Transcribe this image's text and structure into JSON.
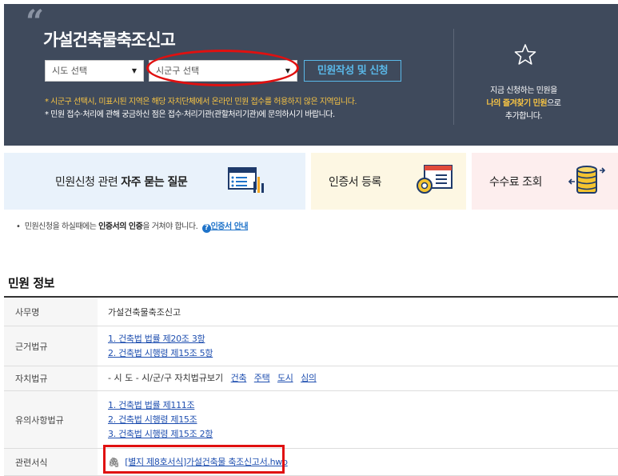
{
  "hero": {
    "title": "가설건축물축조신고",
    "sido_select": "시도 선택",
    "sigungu_select": "시군구 선택",
    "apply_button": "민원작성 및 신청",
    "notice1": "* 시군구 선택시, 미표시된 지역은 해당 자치단체에서 온라인 민원 접수를 허용하지 않은 지역입니다.",
    "notice2": "* 민원 접수·처리에 관해 궁금하신 점은 접수·처리기관(관할처리기관)에 문의하시기 바랍니다.",
    "fav_line1": "지금 신청하는 민원을",
    "fav_highlight": "나의 즐겨찾기 민원",
    "fav_line2_suffix": "으로",
    "fav_line3": "추가합니다."
  },
  "tiles": {
    "faq_prefix": "민원신청 관련 ",
    "faq_bold": "자주 묻는 질문",
    "cert": "인증서 등록",
    "fee": "수수료 조회"
  },
  "cert_note": {
    "prefix": "민원신청을 하실때에는 ",
    "bold": "인증서의 인증",
    "suffix": "을 거쳐야 합니다.",
    "q": "?",
    "link": "인증서 안내"
  },
  "section_title": "민원 정보",
  "info": {
    "work_name_label": "사무명",
    "work_name_value": "가설건축물축조신고",
    "basis_law_label": "근거법규",
    "basis_law_links": [
      "1. 건축법 법률 제20조 3항",
      "2. 건축법 시행령 제15조 5항"
    ],
    "local_law_label": "자치법규",
    "local_law_prefix": "- 시 도 - 시/군/구 자치법규보기",
    "local_law_links": [
      "건축",
      "주택",
      "도시",
      "심의"
    ],
    "caution_law_label": "유의사항법규",
    "caution_law_links": [
      "1. 건축법 법률 제111조",
      "2. 건축법 시행령 제15조",
      "3. 건축법 시행령 제15조 2항"
    ],
    "form_label": "관련서식",
    "form_link": "[별지 제8호서식]가설건축물 축조신고서.hwp"
  },
  "colors": {
    "hero_bg": "#3f4a5c",
    "accent_blue": "#5ab8e8",
    "notice_yellow": "#f6c344",
    "highlight_red": "#e01010",
    "link_blue": "#1f4fb0"
  }
}
